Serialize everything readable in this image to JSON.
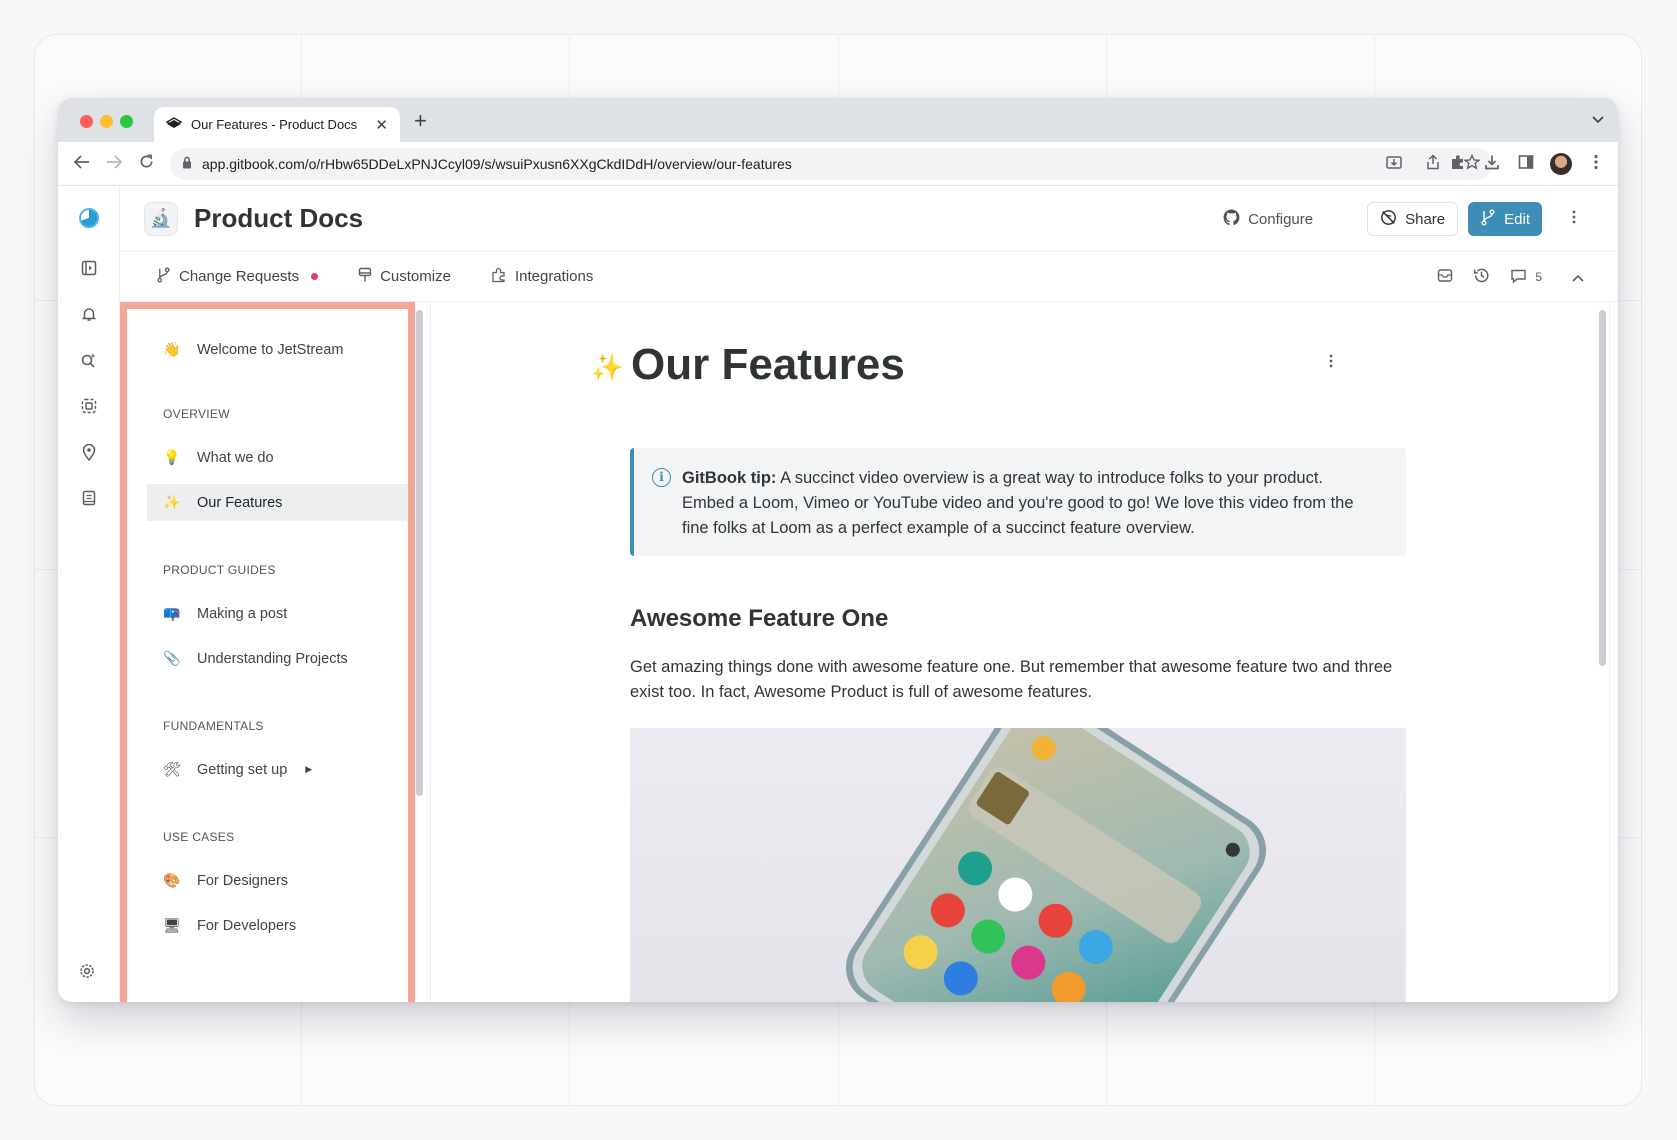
{
  "browser": {
    "tab_title": "Our Features - Product Docs",
    "tab_close": "✕",
    "new_tab": "+",
    "url": "app.gitbook.com/o/rHbw65DDeLxPNJCcyl09/s/wsuiPxusn6XXgCkdIDdH/overview/our-features"
  },
  "header": {
    "space_title": "Product Docs",
    "configure_label": "Configure",
    "share_label": "Share",
    "edit_label": "Edit"
  },
  "subnav": {
    "change_requests_label": "Change Requests",
    "customize_label": "Customize",
    "integrations_label": "Integrations",
    "comments_count": "5"
  },
  "sidebar": {
    "welcome": {
      "emoji": "👋",
      "label": "Welcome to JetStream"
    },
    "sections": [
      {
        "title": "OVERVIEW",
        "items": [
          {
            "emoji": "💡",
            "label": "What we do"
          },
          {
            "emoji": "✨",
            "label": "Our Features",
            "active": true
          }
        ]
      },
      {
        "title": "PRODUCT GUIDES",
        "items": [
          {
            "emoji": "📪",
            "label": "Making a post"
          },
          {
            "emoji": "📎",
            "label": "Understanding Projects"
          }
        ]
      },
      {
        "title": "FUNDAMENTALS",
        "items": [
          {
            "emoji": "🛠",
            "label": "Getting set up",
            "expandable": true
          }
        ]
      },
      {
        "title": "USE CASES",
        "items": [
          {
            "emoji": "🎨",
            "label": "For Designers"
          },
          {
            "emoji": "🖥",
            "label": "For Developers"
          }
        ]
      }
    ]
  },
  "page": {
    "emoji": "✨",
    "title": "Our Features",
    "hint_bold": "GitBook tip:",
    "hint_text": " A succinct video overview is a great way to introduce folks to your product. Embed a Loom, Vimeo or YouTube video and you're good to go! We love this video from the fine folks at Loom as a perfect example of a succinct feature overview.",
    "h2": "Awesome Feature One",
    "paragraph": "Get amazing things done with awesome feature one. But remember that awesome feature two and three exist too. In fact, Awesome Product is full of awesome features."
  },
  "colors": {
    "accent": "#3d8db6",
    "highlight_border": "#f4a596",
    "notification_dot": "#e6396b"
  }
}
